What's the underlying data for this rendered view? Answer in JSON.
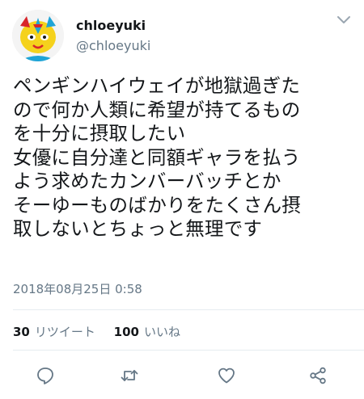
{
  "tweet": {
    "display_name": "chloeyuki",
    "handle": "@chloeyuki",
    "text_lines": [
      "ペンギンハイウェイが地獄過ぎた",
      "ので何か人類に希望が持てるもの",
      "を十分に摂取したい",
      "女優に自分達と同額ギャラを払う",
      "よう求めたカンバーバッチとか",
      "そーゆーものばかりをたくさん摂",
      "取しないとちょっと無理です"
    ],
    "timestamp": "2018年08月25日 0:58",
    "retweet_count": "30",
    "retweet_label": "リツイート",
    "like_count": "100",
    "like_label": "いいね"
  },
  "icons": {
    "caret": "chevron-down-icon",
    "reply": "reply-icon",
    "retweet": "retweet-icon",
    "like": "heart-icon",
    "share": "share-icon"
  },
  "colors": {
    "text": "#14171a",
    "secondary": "#657786",
    "divider": "#e6ecf0",
    "avatar_yellow": "#f5d21c",
    "avatar_blue": "#1fa4d6",
    "avatar_red": "#d8252b"
  }
}
